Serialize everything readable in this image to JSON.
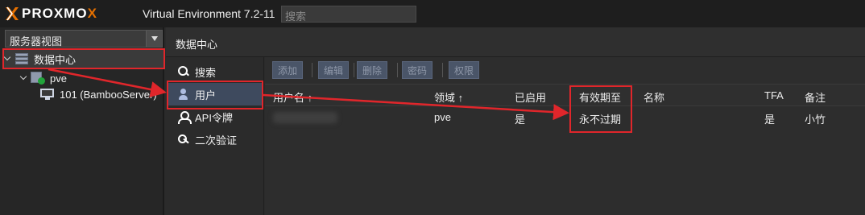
{
  "header": {
    "logo_text": "PROXMOX",
    "product_title": "Virtual Environment 7.2-11",
    "search_placeholder": "搜索"
  },
  "sidebar": {
    "view_select": "服务器视图",
    "tree": [
      {
        "label": "数据中心",
        "icon": "datacenter-icon"
      },
      {
        "label": "pve",
        "icon": "node-online-icon"
      },
      {
        "label": "101 (BambooServer)",
        "icon": "vm-monitor-icon"
      }
    ]
  },
  "breadcrumb": "数据中心",
  "subnav": [
    {
      "label": "搜索",
      "icon": "search-icon"
    },
    {
      "label": "用户",
      "icon": "user-icon"
    },
    {
      "label": "API令牌",
      "icon": "api-token-icon"
    },
    {
      "label": "二次验证",
      "icon": "key-icon"
    }
  ],
  "toolbar": {
    "add": "添加",
    "edit": "编辑",
    "delete": "删除",
    "password": "密码",
    "permissions": "权限"
  },
  "table": {
    "columns": [
      "用户名 ↑",
      "领域 ↑",
      "已启用",
      "有效期至",
      "名称",
      "TFA",
      "备注"
    ],
    "rows": [
      {
        "username": "",
        "realm": "pve",
        "enabled": "是",
        "expire": "永不过期",
        "name": "",
        "tfa": "是",
        "comment": "小竹"
      }
    ]
  },
  "colors": {
    "annotation": "#e0262b",
    "brand_orange": "#e57000",
    "selected_nav": "#3e4a5e"
  }
}
